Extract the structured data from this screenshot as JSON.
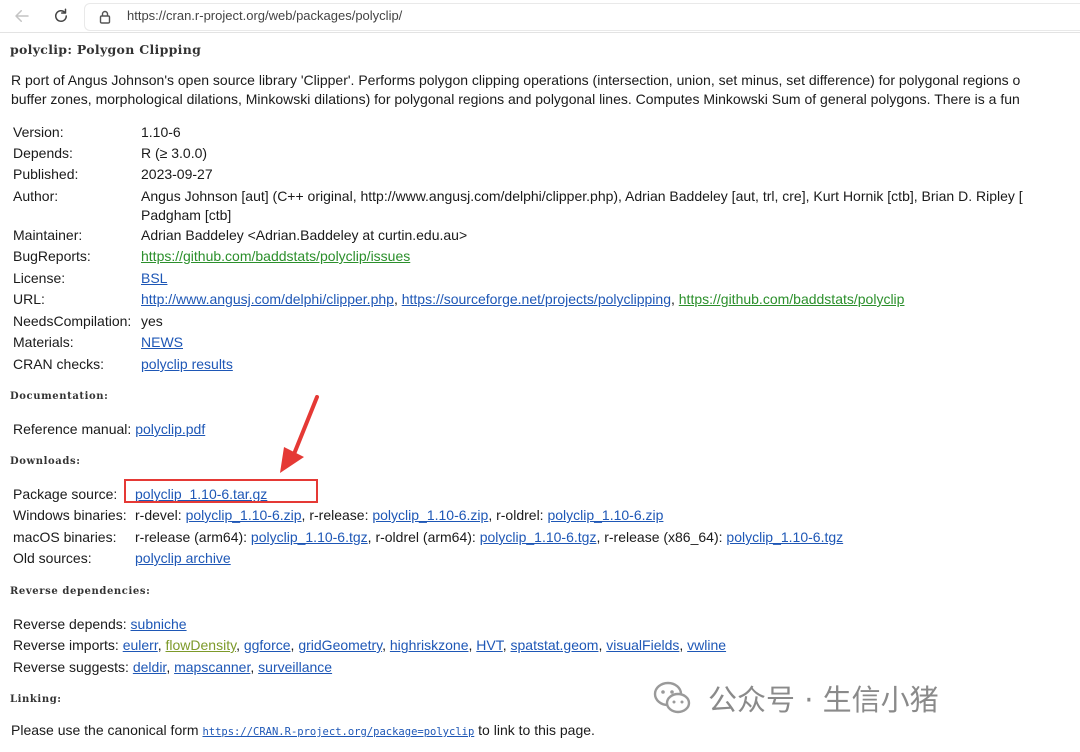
{
  "browser": {
    "url": "https://cran.r-project.org/web/packages/polyclip/"
  },
  "title": "polyclip: Polygon Clipping",
  "description": {
    "line1": "R port of Angus Johnson's open source library 'Clipper'. Performs polygon clipping operations (intersection, union, set minus, set difference) for polygonal regions o",
    "line2": "buffer zones, morphological dilations, Minkowski dilations) for polygonal regions and polygonal lines. Computes Minkowski Sum of general polygons. There is a fun"
  },
  "meta": {
    "version_label": "Version:",
    "version": "1.10-6",
    "depends_label": "Depends:",
    "depends": "R (≥ 3.0.0)",
    "published_label": "Published:",
    "published": "2023-09-27",
    "author_label": "Author:",
    "author_line1": "Angus Johnson [aut] (C++ original, http://www.angusj.com/delphi/clipper.php), Adrian Baddeley [aut, trl, cre], Kurt Hornik [ctb], Brian D. Ripley [",
    "author_line2": "Padgham [ctb]",
    "maintainer_label": "Maintainer:",
    "maintainer": "Adrian Baddeley <Adrian.Baddeley at curtin.edu.au>",
    "bugreports_label": "BugReports:",
    "bugreports": "https://github.com/baddstats/polyclip/issues",
    "license_label": "License:",
    "license": "BSL",
    "url_label": "URL:",
    "url1": "http://www.angusj.com/delphi/clipper.php",
    "url_sep1": ", ",
    "url2": "https://sourceforge.net/projects/polyclipping",
    "url_sep2": ", ",
    "url3": "https://github.com/baddstats/polyclip",
    "needscomp_label": "NeedsCompilation:",
    "needscomp": "yes",
    "materials_label": "Materials:",
    "materials": "NEWS",
    "checks_label": "CRAN checks:",
    "checks": "polyclip results"
  },
  "documentation": {
    "heading": "Documentation:",
    "manual_label": "Reference manual:",
    "manual": "polyclip.pdf"
  },
  "downloads": {
    "heading": "Downloads:",
    "source_label": "Package source:",
    "source": "polyclip_1.10-6.tar.gz",
    "win_label": "Windows binaries:",
    "win_devel_prefix": "r-devel: ",
    "win_devel": "polyclip_1.10-6.zip",
    "win_release_prefix": ", r-release: ",
    "win_release": "polyclip_1.10-6.zip",
    "win_oldrel_prefix": ", r-oldrel: ",
    "win_oldrel": "polyclip_1.10-6.zip",
    "mac_label": "macOS binaries:",
    "mac_1_prefix": "r-release (arm64): ",
    "mac_1": "polyclip_1.10-6.tgz",
    "mac_2_prefix": ", r-oldrel (arm64): ",
    "mac_2": "polyclip_1.10-6.tgz",
    "mac_3_prefix": ", r-release (x86_64): ",
    "mac_3": "polyclip_1.10-6.tgz",
    "old_label": "Old sources:",
    "old": "polyclip archive"
  },
  "reverse": {
    "heading": "Reverse dependencies:",
    "depends_label": "Reverse depends:",
    "depends": [
      "subniche"
    ],
    "imports_label": "Reverse imports:",
    "imports": [
      "eulerr",
      "flowDensity",
      "ggforce",
      "gridGeometry",
      "highriskzone",
      "HVT",
      "spatstat.geom",
      "visualFields",
      "vwline"
    ],
    "suggests_label": "Reverse suggests:",
    "suggests": [
      "deldir",
      "mapscanner",
      "surveillance"
    ]
  },
  "linking": {
    "heading": "Linking:",
    "prefix": "Please use the canonical form ",
    "link": "https://CRAN.R-project.org/package=polyclip",
    "suffix": " to link to this page."
  },
  "watermark": {
    "text": "公众号 · 生信小猪"
  },
  "colors": {
    "link": "#1e57b6",
    "visited_link": "#2b8f2b",
    "annotation": "#e53935"
  }
}
